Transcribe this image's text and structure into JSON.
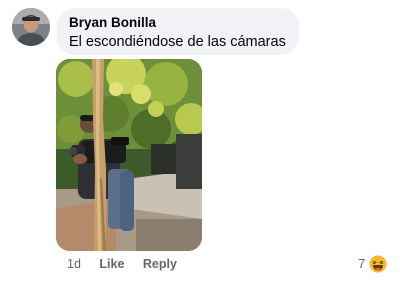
{
  "comment": {
    "author": "Bryan Bonilla",
    "text": "El escondiéndose de las cámaras",
    "timestamp": "1d",
    "like_label": "Like",
    "reply_label": "Reply",
    "reaction_count": "7",
    "reaction_icon": "haha-emoji-icon",
    "avatar_icon": "profile-avatar",
    "attachment": "photo-man-with-camera-behind-tree"
  },
  "colors": {
    "bubble_bg": "#f0f2f5",
    "text_primary": "#050505",
    "text_secondary": "#65676b",
    "reaction_yellow": "#f7b928"
  }
}
